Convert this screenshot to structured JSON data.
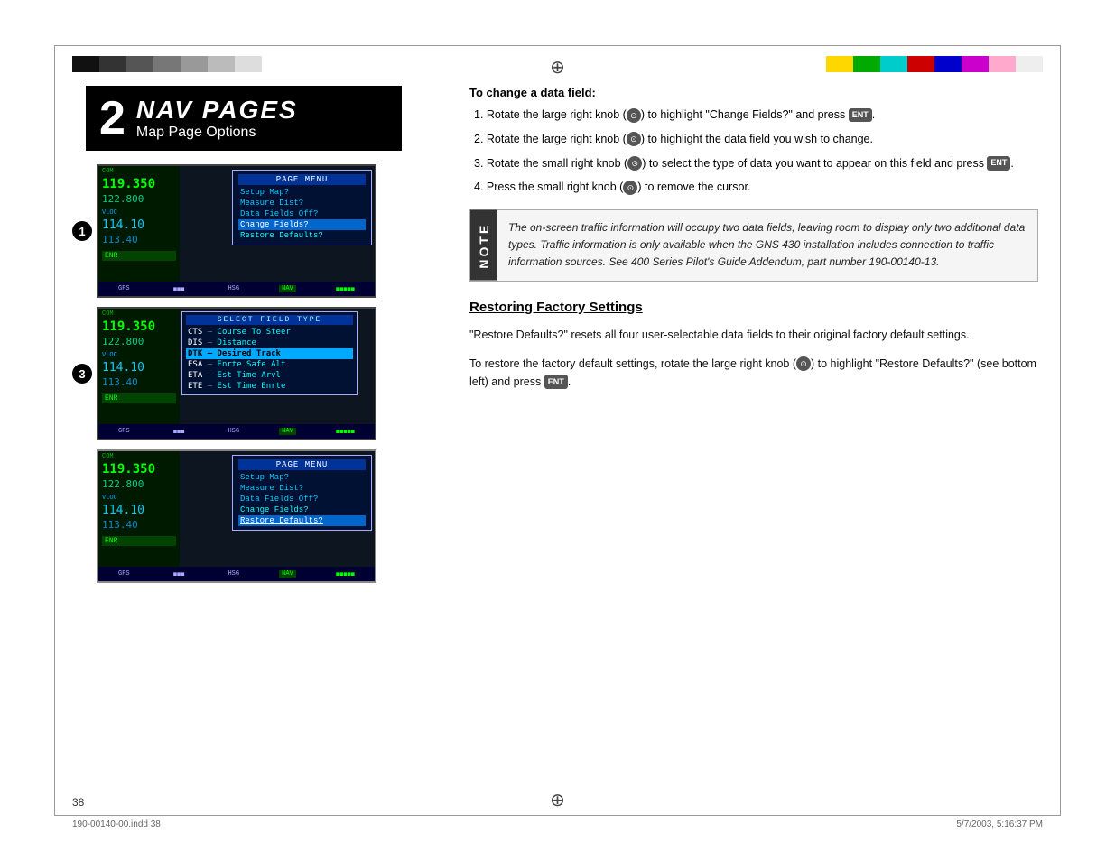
{
  "page": {
    "number": "38",
    "footer_left": "190-00140-00.indd  38",
    "footer_right": "5/7/2003, 5:16:37 PM"
  },
  "nav_header": {
    "number": "2",
    "title": "NAV PAGES",
    "subtitle": "Map Page Options"
  },
  "right_section": {
    "intro": "To change a data field:",
    "steps": [
      "1. Rotate the large right knob (⊙) to highlight \"Change Fields?\" and press ENT.",
      "2. Rotate the large right knob (⊙) to highlight the data field you wish to change.",
      "3. Rotate the small right knob (⊙) to select the type of data you want to appear on this field and press ENT.",
      "4. Press the small right knob (⊙) to remove the cursor."
    ],
    "note_text": "The on-screen traffic information will occupy two data fields, leaving room to display only two additional data types. Traffic information is only available when the GNS 430 installation includes connection to traffic information sources. See 400 Series Pilot's Guide Addendum, part number 190-00140-13.",
    "note_label": "NOTE",
    "heading": "Restoring Factory Settings",
    "body1": "\"Restore Defaults?\" resets all four user-selectable data fields to their original factory default settings.",
    "body2": "To restore the factory default settings, rotate the large right knob (⊙) to highlight \"Restore Defaults?\" (see bottom left) and press ENT."
  },
  "gps_screens": {
    "screen1": {
      "com_label": "COM",
      "freq_main": "119.350",
      "freq_sec": "122.800",
      "vloc_label": "VLOC",
      "freq3": "114.10",
      "freq4": "113.40",
      "enr": "ENR",
      "bottom": [
        "GPS",
        "HSG",
        "NAV"
      ],
      "menu_title": "PAGE MENU",
      "menu_items": [
        "Setup Map?",
        "Measure Dist?",
        "Data Fields Off?",
        "Change Fields?",
        "Restore Defaults?"
      ],
      "highlighted": 3
    },
    "screen2": {
      "com_label": "COM",
      "freq_main": "119.350",
      "freq_sec": "122.800",
      "vloc_label": "VLOC",
      "freq3": "114.10",
      "freq4": "113.40",
      "enr": "ENR",
      "bottom": [
        "GPS",
        "HSG",
        "NAV"
      ],
      "select_title": "SELECT FIELD TYPE",
      "select_items": [
        {
          "label": "CTS",
          "desc": "Course To Steer"
        },
        {
          "label": "DIS",
          "desc": "Distance"
        },
        {
          "label": "DTK",
          "desc": "Desired Track",
          "highlighted": true
        },
        {
          "label": "ESA",
          "desc": "Enrte Safe Alt"
        },
        {
          "label": "ETA",
          "desc": "Est Time Arvl"
        },
        {
          "label": "ETE",
          "desc": "Est Time Enrte"
        }
      ]
    },
    "screen3": {
      "com_label": "COM",
      "freq_main": "119.350",
      "freq_sec": "122.800",
      "vloc_label": "VLOC",
      "freq3": "114.10",
      "freq4": "113.40",
      "enr": "ENR",
      "bottom": [
        "GPS",
        "HSG",
        "NAV"
      ],
      "menu_title": "PAGE MENU",
      "menu_items": [
        "Setup Map?",
        "Measure Dist?",
        "Data Fields Off?",
        "Change Fields?",
        "Restore Defaults?"
      ],
      "highlighted": 4
    }
  }
}
